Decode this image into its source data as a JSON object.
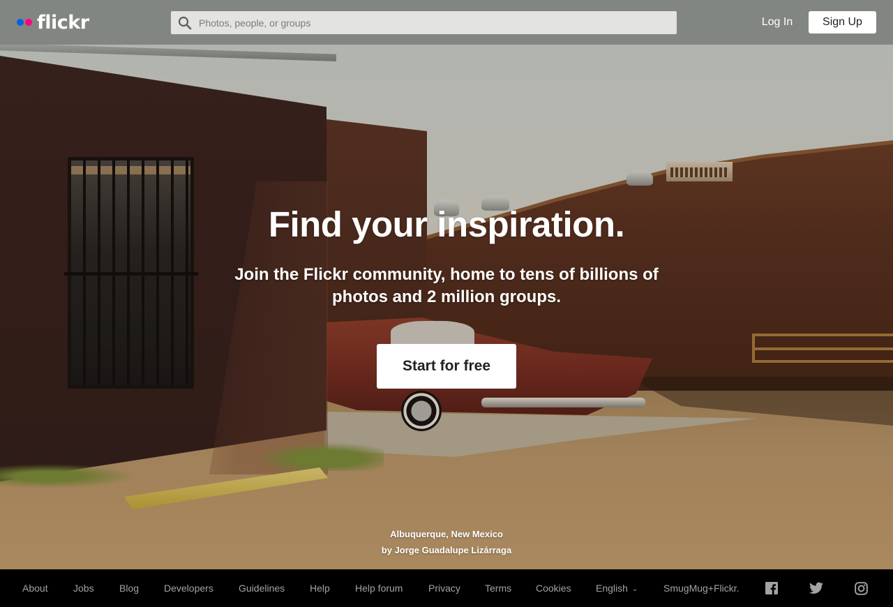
{
  "header": {
    "logo_text": "flickr",
    "logo_dot_colors": {
      "blue": "#0063dc",
      "pink": "#ff0084"
    },
    "search_placeholder": "Photos, people, or groups",
    "search_value": "",
    "login_label": "Log In",
    "signup_label": "Sign Up"
  },
  "hero": {
    "title": "Find your inspiration.",
    "subtitle": "Join the Flickr community, home to tens of billions of photos and 2 million groups.",
    "cta_label": "Start for free",
    "photo_location": "Albuquerque, New Mexico",
    "photo_credit": "by Jorge Guadalupe Lizárraga"
  },
  "footer": {
    "links": [
      {
        "label": "About"
      },
      {
        "label": "Jobs"
      },
      {
        "label": "Blog"
      },
      {
        "label": "Developers"
      },
      {
        "label": "Guidelines"
      },
      {
        "label": "Help"
      },
      {
        "label": "Help forum"
      },
      {
        "label": "Privacy"
      },
      {
        "label": "Terms"
      },
      {
        "label": "Cookies"
      }
    ],
    "language": "English",
    "smugmug": "SmugMug+Flickr.",
    "social_icons": [
      "facebook-icon",
      "twitter-icon",
      "instagram-icon"
    ]
  }
}
